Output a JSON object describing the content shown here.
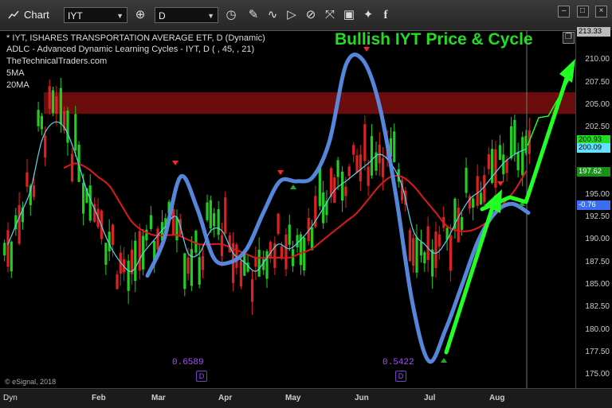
{
  "toolbar": {
    "window_title": "Chart",
    "symbol": "IYT",
    "interval": "D",
    "icons": [
      "crosshair-icon",
      "clock-icon",
      "pencil-icon",
      "wave-icon",
      "play-icon",
      "compare-icon",
      "tag-icon",
      "twitter-icon",
      "facebook-icon"
    ]
  },
  "legend": {
    "line1": "* IYT, ISHARES TRANSPORTATION AVERAGE ETF, D (Dynamic)",
    "line2": "ADLC - Advanced Dynamic Learning Cycles - IYT, D (          , 45,           , 21)",
    "line3": "TheTechnicalTraders.com",
    "line4": "5MA",
    "line5": "20MA"
  },
  "headline": "Bullish IYT Price & Cycle",
  "watermark": "© eSignal, 2018",
  "months": [
    "Feb",
    "Mar",
    "Apr",
    "May",
    "Jun",
    "Jul",
    "Aug"
  ],
  "bottom_label": "Dyn",
  "cycle_values": [
    "0.6589",
    "0.5422"
  ],
  "cycle_tag": "D",
  "price_tags": [
    {
      "text": "213.33",
      "color": "#bbbbbb"
    },
    {
      "text": "200.93",
      "color": "#22dd22"
    },
    {
      "text": "200.09",
      "color": "#66e0ff"
    },
    {
      "text": "197.62",
      "color": "#1a8f1a"
    },
    {
      "text": "-0.76",
      "color": "#3a6df0"
    }
  ],
  "colors": {
    "resistance_band": "#6b0d0d",
    "cycle_line": "#5b8de8",
    "ma5": "#55d8f0",
    "ma20": "#e01818",
    "ma_long": "#1f8a1f",
    "candle_up": "#22cc22",
    "candle_down": "#dd2222",
    "arrow": "#22ff22"
  },
  "chart_data": {
    "type": "line",
    "title": "Bullish IYT Price & Cycle",
    "xlabel": "",
    "ylabel": "",
    "x_ticks": [
      "Feb",
      "Mar",
      "Apr",
      "May",
      "Jun",
      "Jul",
      "Aug"
    ],
    "y_ticks": [
      175.0,
      177.5,
      180.0,
      182.5,
      185.0,
      187.5,
      190.0,
      192.5,
      195.0,
      197.5,
      200.0,
      202.5,
      205.0,
      207.5,
      210.0
    ],
    "ylim": [
      173.5,
      213.3
    ],
    "resistance_band": [
      204.0,
      206.4
    ],
    "series": [
      {
        "name": "IYT",
        "kind": "price",
        "values": [
          189,
          193,
          196,
          202,
          204,
          203,
          200,
          196,
          193,
          190,
          187,
          186,
          189,
          190,
          192,
          193,
          188,
          188,
          192,
          191,
          188,
          187,
          186,
          188,
          190,
          189,
          190,
          192,
          194,
          196,
          197,
          198,
          199,
          200,
          199,
          196,
          190,
          189,
          188,
          190,
          193,
          195,
          196,
          197,
          199,
          200,
          200.9
        ]
      },
      {
        "name": "5MA",
        "kind": "ma",
        "values": [
          189.5,
          192.5,
          195.5,
          201,
          203,
          202.5,
          199.5,
          195.5,
          192.5,
          189.5,
          187.5,
          186.5,
          188.5,
          190,
          191.5,
          192.5,
          188.5,
          188.5,
          191,
          191,
          188.5,
          187.5,
          186.5,
          188,
          189.5,
          189,
          190,
          191.5,
          193.5,
          195.5,
          196.5,
          197.5,
          198.5,
          199.5,
          198.5,
          196,
          191,
          189.5,
          188.5,
          190,
          192.5,
          194.5,
          195.5,
          197,
          198.5,
          199.5,
          200.1
        ]
      },
      {
        "name": "20MA",
        "kind": "ma",
        "values": [
          null,
          null,
          null,
          null,
          null,
          198,
          198.5,
          198,
          197,
          196,
          194,
          192,
          191,
          190.5,
          190.5,
          190.5,
          190,
          189.5,
          189.5,
          189.5,
          189,
          188.5,
          188,
          188,
          188,
          188,
          188.5,
          189,
          190,
          191,
          192,
          193,
          194.5,
          196,
          197,
          197,
          196,
          194.5,
          193,
          191.5,
          191,
          191,
          191.5,
          192.5,
          194,
          195.5,
          197.6
        ]
      },
      {
        "name": "ADLC",
        "kind": "cycle",
        "values": [
          null,
          null,
          null,
          null,
          null,
          null,
          null,
          null,
          null,
          186,
          190,
          197,
          193.5,
          188,
          187.5,
          189,
          193,
          196.5,
          196.5,
          197,
          201,
          209.5,
          210,
          205,
          195,
          183,
          176.5,
          180,
          185,
          190,
          193,
          194,
          193
        ]
      }
    ]
  }
}
